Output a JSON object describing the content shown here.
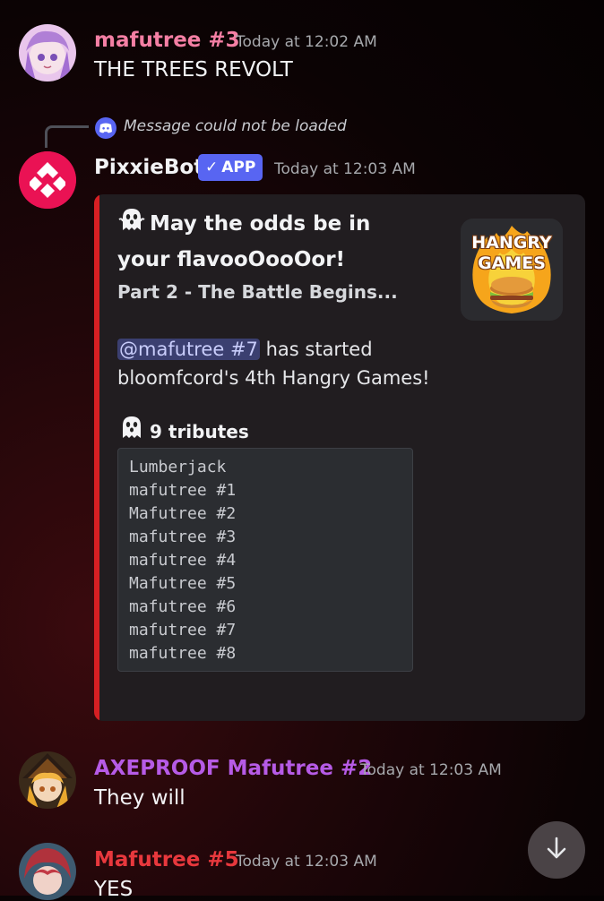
{
  "messages": [
    {
      "username": "mafutree #3",
      "username_color": "#f47fa4",
      "timestamp": "Today at 12:02 AM",
      "text": "THE TREES REVOLT"
    },
    {
      "reply_text": "Message could not be loaded",
      "username": "PixxieBot",
      "username_color": "#f2f3f5",
      "badge": "APP",
      "timestamp": "Today at 12:03 AM",
      "embed": {
        "accent_color": "#d71f23",
        "title": "May the odds be in your flavooOooOor!",
        "subtitle": "Part 2 - The Battle Begins...",
        "mention": "@mafutree #7",
        "description_line1": "has started",
        "description_line2": "bloomfcord's 4th Hangry Games!",
        "thumbnail_text_1": "HANGRY",
        "thumbnail_text_2": "GAMES",
        "field_name": "9 tributes",
        "tributes": [
          "Lumberjack",
          "mafutree #1",
          "Mafutree #2",
          "mafutree #3",
          "mafutree #4",
          "Mafutree #5",
          "mafutree #6",
          "mafutree #7",
          "mafutree #8"
        ]
      }
    },
    {
      "username": "AXEPROOF Mafutree #2",
      "username_color": "#b65be6",
      "timestamp": "Today at 12:03 AM",
      "text": "They will"
    },
    {
      "username": "Mafutree #5",
      "username_color": "#e8383d",
      "timestamp": "Today at 12:03 AM",
      "text": "YES"
    }
  ],
  "icons": {
    "reply": "discord-logo-icon",
    "ghost": "ghost-icon",
    "scroll": "arrow-down-icon"
  }
}
